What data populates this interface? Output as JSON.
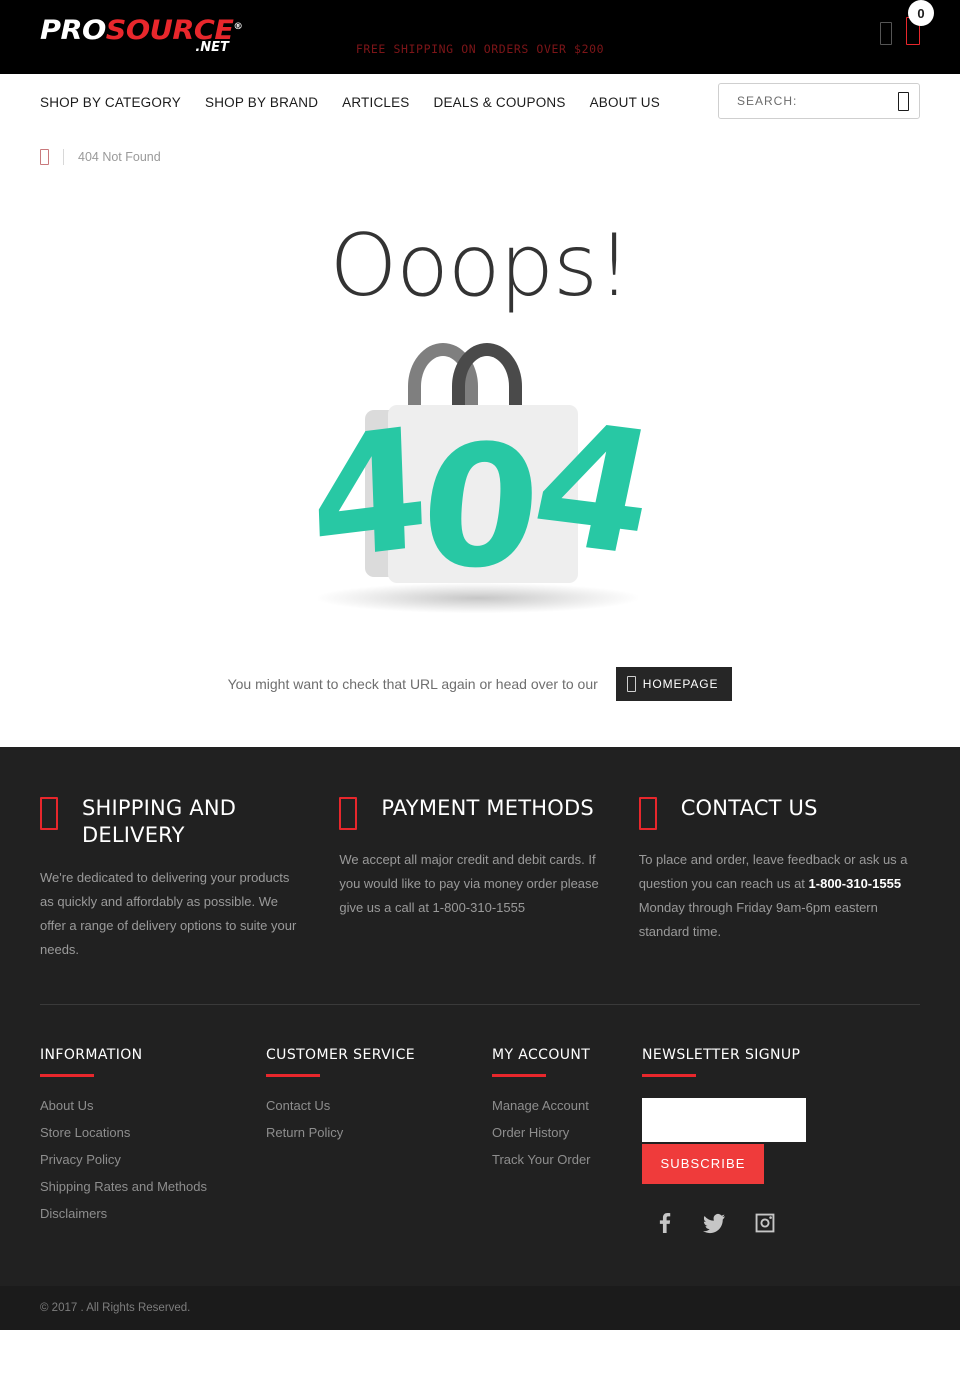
{
  "header": {
    "logo": {
      "part1": "PRO",
      "part2": "SOURCE",
      "reg": "®",
      "tld": ".NET"
    },
    "shipping_banner": "FREE SHIPPING ON ORDERS OVER $200",
    "account_icon": "user-icon",
    "cart_icon": "shopping-cart-icon",
    "cart_count": "0"
  },
  "nav": {
    "items": [
      {
        "label": "SHOP BY CATEGORY"
      },
      {
        "label": "SHOP BY BRAND"
      },
      {
        "label": "ARTICLES"
      },
      {
        "label": "DEALS & COUPONS"
      },
      {
        "label": "ABOUT US"
      }
    ]
  },
  "search": {
    "placeholder": "SEARCH:",
    "value": "",
    "icon": "search-icon"
  },
  "breadcrumb": {
    "home_icon": "home-icon",
    "current": "404 Not Found"
  },
  "main": {
    "heading": "Ooops!",
    "illustration": {
      "name": "shopping-bag-404-illustration",
      "digit_left": "4",
      "digit_middle": "0",
      "digit_right": "4",
      "digit_color": "#28c8a4",
      "bag_front_color": "#eeeeee",
      "bag_back_color": "#dbdbdb",
      "handle_left_color": "#7f7f7f",
      "handle_right_color": "#4a4a4a"
    },
    "message": "You might want to check that URL again or head over to our",
    "homepage_button": {
      "label": "HOMEPAGE",
      "icon": "home-icon"
    }
  },
  "footer": {
    "features": [
      {
        "icon": "truck-icon",
        "title": "SHIPPING AND DELIVERY",
        "body": "We're dedicated to delivering your products as quickly and affordably as possible. We offer a range of delivery options to suite your needs."
      },
      {
        "icon": "credit-card-icon",
        "title": "PAYMENT METHODS",
        "body": "We accept all major credit and debit cards. If you would like to pay via money order please give us a call at 1-800-310-1555"
      },
      {
        "icon": "phone-icon",
        "title": "CONTACT US",
        "body_pre": "To place and order, leave feedback or ask us a question you can reach us at ",
        "body_phone": "1-800-310-1555",
        "body_post": " Monday through Friday 9am-6pm eastern standard time."
      }
    ],
    "link_columns": [
      {
        "heading": "INFORMATION",
        "links": [
          {
            "label": "About Us"
          },
          {
            "label": "Store Locations"
          },
          {
            "label": "Privacy Policy"
          },
          {
            "label": "Shipping Rates and Methods"
          },
          {
            "label": "Disclaimers"
          }
        ]
      },
      {
        "heading": "CUSTOMER SERVICE",
        "links": [
          {
            "label": "Contact Us"
          },
          {
            "label": "Return Policy"
          }
        ]
      },
      {
        "heading": "MY ACCOUNT",
        "links": [
          {
            "label": "Manage Account"
          },
          {
            "label": "Order History"
          },
          {
            "label": "Track Your Order"
          }
        ]
      }
    ],
    "newsletter": {
      "heading": "NEWSLETTER SIGNUP",
      "input_value": "",
      "input_placeholder": "",
      "subscribe_label": "SUBSCRIBE"
    },
    "socials": [
      {
        "name": "facebook-icon"
      },
      {
        "name": "twitter-icon"
      },
      {
        "name": "instagram-icon"
      }
    ],
    "copyright": "© 2017 . All Rights Reserved."
  },
  "colors": {
    "brand_red": "#e8272c",
    "subscribe_red": "#ef3b3b",
    "footer_bg": "#212121",
    "copy_bg": "#1b1b1b",
    "teal": "#28c8a4"
  }
}
